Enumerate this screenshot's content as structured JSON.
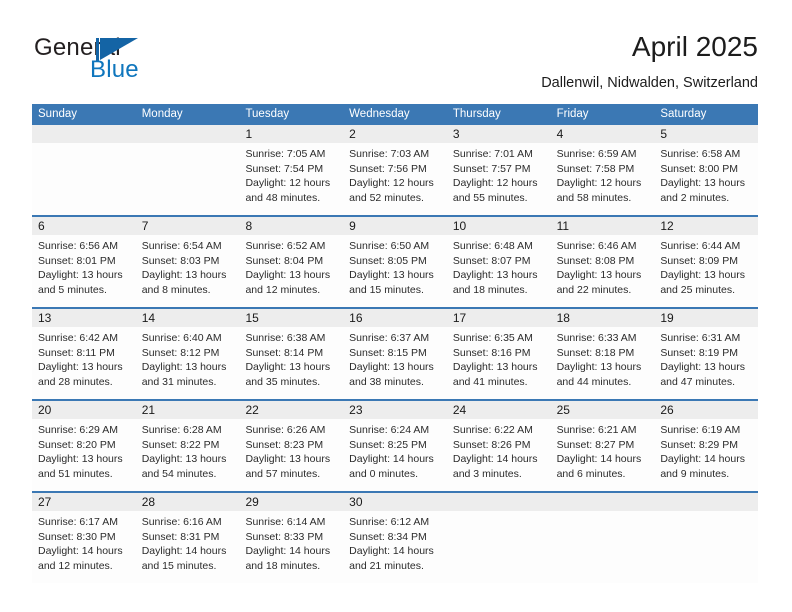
{
  "brand": {
    "name_part1": "General",
    "name_part2": "Blue",
    "logo_icon": "general-blue-flag-logo"
  },
  "header": {
    "title": "April 2025",
    "subtitle": "Dallenwil, Nidwalden, Switzerland"
  },
  "colors": {
    "header_blue": "#3b78b4",
    "brand_blue": "#0f76bd",
    "daynum_band": "#ededed",
    "cell_background": "#fdfdfd"
  },
  "weekdays": [
    "Sunday",
    "Monday",
    "Tuesday",
    "Wednesday",
    "Thursday",
    "Friday",
    "Saturday"
  ],
  "weeks": [
    [
      {
        "day": "",
        "sunrise": "",
        "sunset": "",
        "daylight_line1": "",
        "daylight_line2": ""
      },
      {
        "day": "",
        "sunrise": "",
        "sunset": "",
        "daylight_line1": "",
        "daylight_line2": ""
      },
      {
        "day": "1",
        "sunrise": "Sunrise: 7:05 AM",
        "sunset": "Sunset: 7:54 PM",
        "daylight_line1": "Daylight: 12 hours",
        "daylight_line2": "and 48 minutes."
      },
      {
        "day": "2",
        "sunrise": "Sunrise: 7:03 AM",
        "sunset": "Sunset: 7:56 PM",
        "daylight_line1": "Daylight: 12 hours",
        "daylight_line2": "and 52 minutes."
      },
      {
        "day": "3",
        "sunrise": "Sunrise: 7:01 AM",
        "sunset": "Sunset: 7:57 PM",
        "daylight_line1": "Daylight: 12 hours",
        "daylight_line2": "and 55 minutes."
      },
      {
        "day": "4",
        "sunrise": "Sunrise: 6:59 AM",
        "sunset": "Sunset: 7:58 PM",
        "daylight_line1": "Daylight: 12 hours",
        "daylight_line2": "and 58 minutes."
      },
      {
        "day": "5",
        "sunrise": "Sunrise: 6:58 AM",
        "sunset": "Sunset: 8:00 PM",
        "daylight_line1": "Daylight: 13 hours",
        "daylight_line2": "and 2 minutes."
      }
    ],
    [
      {
        "day": "6",
        "sunrise": "Sunrise: 6:56 AM",
        "sunset": "Sunset: 8:01 PM",
        "daylight_line1": "Daylight: 13 hours",
        "daylight_line2": "and 5 minutes."
      },
      {
        "day": "7",
        "sunrise": "Sunrise: 6:54 AM",
        "sunset": "Sunset: 8:03 PM",
        "daylight_line1": "Daylight: 13 hours",
        "daylight_line2": "and 8 minutes."
      },
      {
        "day": "8",
        "sunrise": "Sunrise: 6:52 AM",
        "sunset": "Sunset: 8:04 PM",
        "daylight_line1": "Daylight: 13 hours",
        "daylight_line2": "and 12 minutes."
      },
      {
        "day": "9",
        "sunrise": "Sunrise: 6:50 AM",
        "sunset": "Sunset: 8:05 PM",
        "daylight_line1": "Daylight: 13 hours",
        "daylight_line2": "and 15 minutes."
      },
      {
        "day": "10",
        "sunrise": "Sunrise: 6:48 AM",
        "sunset": "Sunset: 8:07 PM",
        "daylight_line1": "Daylight: 13 hours",
        "daylight_line2": "and 18 minutes."
      },
      {
        "day": "11",
        "sunrise": "Sunrise: 6:46 AM",
        "sunset": "Sunset: 8:08 PM",
        "daylight_line1": "Daylight: 13 hours",
        "daylight_line2": "and 22 minutes."
      },
      {
        "day": "12",
        "sunrise": "Sunrise: 6:44 AM",
        "sunset": "Sunset: 8:09 PM",
        "daylight_line1": "Daylight: 13 hours",
        "daylight_line2": "and 25 minutes."
      }
    ],
    [
      {
        "day": "13",
        "sunrise": "Sunrise: 6:42 AM",
        "sunset": "Sunset: 8:11 PM",
        "daylight_line1": "Daylight: 13 hours",
        "daylight_line2": "and 28 minutes."
      },
      {
        "day": "14",
        "sunrise": "Sunrise: 6:40 AM",
        "sunset": "Sunset: 8:12 PM",
        "daylight_line1": "Daylight: 13 hours",
        "daylight_line2": "and 31 minutes."
      },
      {
        "day": "15",
        "sunrise": "Sunrise: 6:38 AM",
        "sunset": "Sunset: 8:14 PM",
        "daylight_line1": "Daylight: 13 hours",
        "daylight_line2": "and 35 minutes."
      },
      {
        "day": "16",
        "sunrise": "Sunrise: 6:37 AM",
        "sunset": "Sunset: 8:15 PM",
        "daylight_line1": "Daylight: 13 hours",
        "daylight_line2": "and 38 minutes."
      },
      {
        "day": "17",
        "sunrise": "Sunrise: 6:35 AM",
        "sunset": "Sunset: 8:16 PM",
        "daylight_line1": "Daylight: 13 hours",
        "daylight_line2": "and 41 minutes."
      },
      {
        "day": "18",
        "sunrise": "Sunrise: 6:33 AM",
        "sunset": "Sunset: 8:18 PM",
        "daylight_line1": "Daylight: 13 hours",
        "daylight_line2": "and 44 minutes."
      },
      {
        "day": "19",
        "sunrise": "Sunrise: 6:31 AM",
        "sunset": "Sunset: 8:19 PM",
        "daylight_line1": "Daylight: 13 hours",
        "daylight_line2": "and 47 minutes."
      }
    ],
    [
      {
        "day": "20",
        "sunrise": "Sunrise: 6:29 AM",
        "sunset": "Sunset: 8:20 PM",
        "daylight_line1": "Daylight: 13 hours",
        "daylight_line2": "and 51 minutes."
      },
      {
        "day": "21",
        "sunrise": "Sunrise: 6:28 AM",
        "sunset": "Sunset: 8:22 PM",
        "daylight_line1": "Daylight: 13 hours",
        "daylight_line2": "and 54 minutes."
      },
      {
        "day": "22",
        "sunrise": "Sunrise: 6:26 AM",
        "sunset": "Sunset: 8:23 PM",
        "daylight_line1": "Daylight: 13 hours",
        "daylight_line2": "and 57 minutes."
      },
      {
        "day": "23",
        "sunrise": "Sunrise: 6:24 AM",
        "sunset": "Sunset: 8:25 PM",
        "daylight_line1": "Daylight: 14 hours",
        "daylight_line2": "and 0 minutes."
      },
      {
        "day": "24",
        "sunrise": "Sunrise: 6:22 AM",
        "sunset": "Sunset: 8:26 PM",
        "daylight_line1": "Daylight: 14 hours",
        "daylight_line2": "and 3 minutes."
      },
      {
        "day": "25",
        "sunrise": "Sunrise: 6:21 AM",
        "sunset": "Sunset: 8:27 PM",
        "daylight_line1": "Daylight: 14 hours",
        "daylight_line2": "and 6 minutes."
      },
      {
        "day": "26",
        "sunrise": "Sunrise: 6:19 AM",
        "sunset": "Sunset: 8:29 PM",
        "daylight_line1": "Daylight: 14 hours",
        "daylight_line2": "and 9 minutes."
      }
    ],
    [
      {
        "day": "27",
        "sunrise": "Sunrise: 6:17 AM",
        "sunset": "Sunset: 8:30 PM",
        "daylight_line1": "Daylight: 14 hours",
        "daylight_line2": "and 12 minutes."
      },
      {
        "day": "28",
        "sunrise": "Sunrise: 6:16 AM",
        "sunset": "Sunset: 8:31 PM",
        "daylight_line1": "Daylight: 14 hours",
        "daylight_line2": "and 15 minutes."
      },
      {
        "day": "29",
        "sunrise": "Sunrise: 6:14 AM",
        "sunset": "Sunset: 8:33 PM",
        "daylight_line1": "Daylight: 14 hours",
        "daylight_line2": "and 18 minutes."
      },
      {
        "day": "30",
        "sunrise": "Sunrise: 6:12 AM",
        "sunset": "Sunset: 8:34 PM",
        "daylight_line1": "Daylight: 14 hours",
        "daylight_line2": "and 21 minutes."
      },
      {
        "day": "",
        "sunrise": "",
        "sunset": "",
        "daylight_line1": "",
        "daylight_line2": ""
      },
      {
        "day": "",
        "sunrise": "",
        "sunset": "",
        "daylight_line1": "",
        "daylight_line2": ""
      },
      {
        "day": "",
        "sunrise": "",
        "sunset": "",
        "daylight_line1": "",
        "daylight_line2": ""
      }
    ]
  ]
}
